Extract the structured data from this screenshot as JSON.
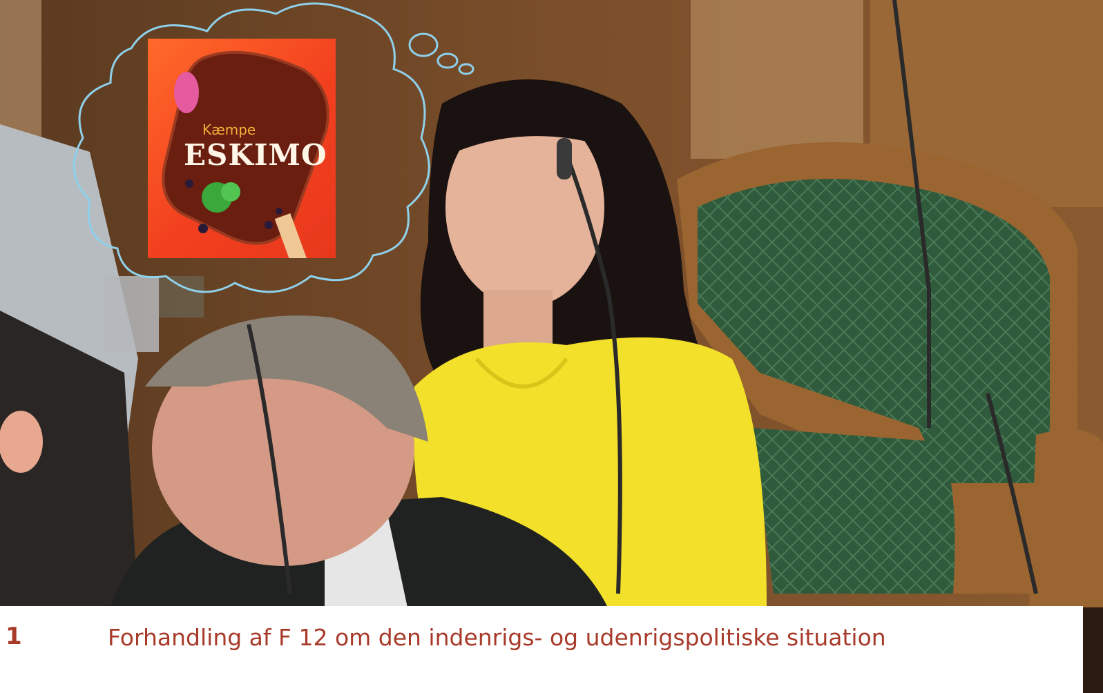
{
  "caption": {
    "number": "1",
    "text": "Forhandling af F 12 om den indenrigs- og udenrigspolitiske situation"
  },
  "ad": {
    "small_text": "Kæmpe",
    "big_text": "ESKIMO"
  },
  "colors": {
    "caption_text": "#a83a2a",
    "thought_bubble": "#8fd0ea",
    "yellow_dress": "#f2e02a",
    "chair_green": "#2f5a3c",
    "wood": "#8b5a2e"
  }
}
